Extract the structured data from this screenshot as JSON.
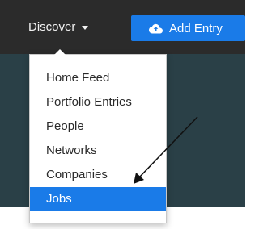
{
  "navbar": {
    "discover_label": "Discover",
    "add_entry_label": "Add Entry"
  },
  "dropdown": {
    "items": [
      {
        "label": "Home Feed",
        "active": false
      },
      {
        "label": "Portfolio Entries",
        "active": false
      },
      {
        "label": "People",
        "active": false
      },
      {
        "label": "Networks",
        "active": false
      },
      {
        "label": "Companies",
        "active": false
      },
      {
        "label": "Jobs",
        "active": true
      }
    ]
  },
  "colors": {
    "navbar_bg": "#2b2b2b",
    "accent": "#1a7be8",
    "panel_bg": "#2a4047"
  },
  "icons": {
    "add_entry_icon": "cloud-upload-icon",
    "discover_caret": "caret-down-icon",
    "annotation_arrow": "arrow-icon"
  }
}
